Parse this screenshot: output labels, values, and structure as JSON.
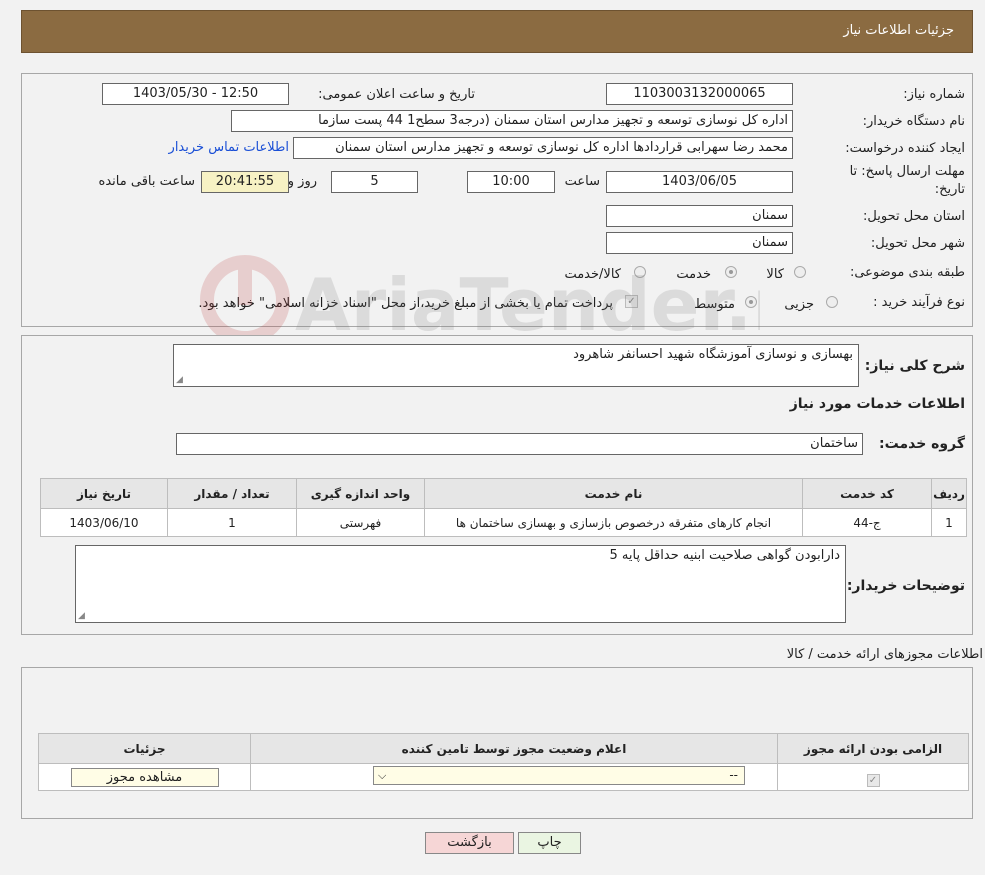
{
  "header": {
    "title": "جزئیات اطلاعات نیاز"
  },
  "form": {
    "need_number": {
      "label": "شماره نیاز:",
      "value": "1103003132000065"
    },
    "announce_datetime": {
      "label": "تاریخ و ساعت اعلان عمومی:",
      "value": "1403/05/30 - 12:50"
    },
    "buyer_org": {
      "label": "نام دستگاه خریدار:",
      "value": "اداره کل نوسازی   توسعه و تجهیز مدارس استان سمنان (درجه3  سطح1  44 پست سازما"
    },
    "requester": {
      "label": "ایجاد کننده درخواست:",
      "value": "محمد رضا سهرابی قراردادها اداره کل نوسازی   توسعه و تجهیز مدارس استان سمنان",
      "contact_link": "اطلاعات تماس خریدار"
    },
    "deadline": {
      "label_line1": "مهلت ارسال پاسخ: تا",
      "label_line2": "تاریخ:",
      "date": "1403/06/05",
      "time_label": "ساعت",
      "time": "10:00",
      "days": "5",
      "days_label": "روز و",
      "remaining": "20:41:55",
      "remaining_label": "ساعت باقی مانده"
    },
    "delivery_province": {
      "label": "استان محل تحویل:",
      "value": "سمنان"
    },
    "delivery_city": {
      "label": "شهر محل تحویل:",
      "value": "سمنان"
    },
    "category": {
      "label": "طبقه بندی موضوعی:",
      "options": [
        "کالا",
        "خدمت",
        "کالا/خدمت"
      ],
      "selected": "خدمت"
    },
    "purchase_type": {
      "label": "نوع فرآیند خرید :",
      "options": [
        "جزیی",
        "متوسط"
      ],
      "selected": "متوسط",
      "note": "پرداخت تمام یا بخشی از مبلغ خرید،از محل \"اسناد خزانه اسلامی\" خواهد بود."
    }
  },
  "description": {
    "label": "شرح کلی نیاز:",
    "value": "بهسازی و نوسازی آموزشگاه شهید احسانفر شاهرود",
    "services_title": "اطلاعات خدمات مورد نیاز",
    "service_group_label": "گروه خدمت:",
    "service_group": "ساختمان",
    "table": {
      "headers": [
        "ردیف",
        "کد خدمت",
        "نام خدمت",
        "واحد اندازه گیری",
        "تعداد / مقدار",
        "تاریخ نیاز"
      ],
      "rows": [
        [
          "1",
          "ج-44",
          "انجام کارهای متفرقه درخصوص بازسازی و بهسازی ساختمان ها",
          "فهرستی",
          "1",
          "1403/06/10"
        ]
      ]
    },
    "buyer_notes_label": "توضیحات خریدار:",
    "buyer_notes": "دارابودن گواهی صلاحیت ابنیه حداقل پایه 5"
  },
  "permits": {
    "title": "اطلاعات مجوزهای ارائه خدمت / کالا",
    "headers": [
      "الزامی بودن ارائه مجوز",
      "اعلام وضعیت مجوز توسط تامین کننده",
      "جزئیات"
    ],
    "select_value": "--",
    "view_button": "مشاهده مجوز"
  },
  "buttons": {
    "print": "چاپ",
    "back": "بازگشت"
  },
  "colors": {
    "header_bg": "#8b6b41",
    "back_button_bg": "#f6d6d6",
    "print_button_bg": "#eaf5e2",
    "link": "#1a4fd6"
  }
}
